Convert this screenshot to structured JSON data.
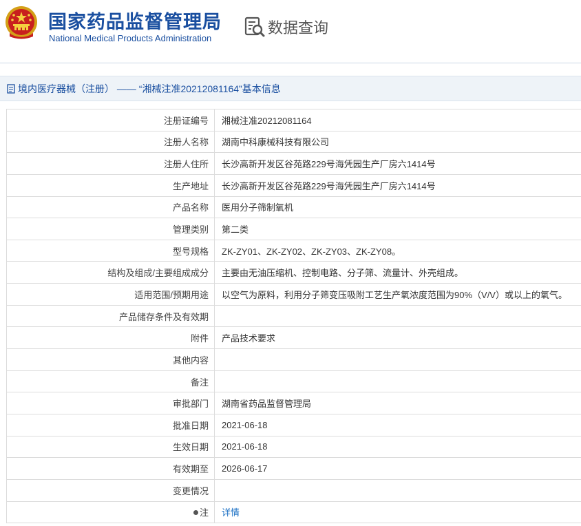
{
  "header": {
    "title_cn": "国家药品监督管理局",
    "title_en": "National Medical Products Administration",
    "query_label": "数据查询",
    "emblem_icon": "national-emblem-icon",
    "query_icon": "document-search-icon"
  },
  "breadcrumb": {
    "text": "境内医疗器械（注册） —— “湘械注准20212081164”基本信息",
    "icon": "document-icon"
  },
  "colors": {
    "brand": "#1a4fa0",
    "link": "#1a6fc4",
    "breadcrumb_bg": "#eef3f8",
    "border": "#dcdcdc"
  },
  "rows": [
    {
      "label": "注册证编号",
      "value": "湘械注准20212081164"
    },
    {
      "label": "注册人名称",
      "value": "湖南中科康械科技有限公司"
    },
    {
      "label": "注册人住所",
      "value": "长沙高新开发区谷苑路229号海凭园生产厂房六1414号"
    },
    {
      "label": "生产地址",
      "value": "长沙高新开发区谷苑路229号海凭园生产厂房六1414号"
    },
    {
      "label": "产品名称",
      "value": "医用分子筛制氧机"
    },
    {
      "label": "管理类别",
      "value": "第二类"
    },
    {
      "label": "型号规格",
      "value": "ZK-ZY01、ZK-ZY02、ZK-ZY03、ZK-ZY08。"
    },
    {
      "label": "结构及组成/主要组成成分",
      "value": "主要由无油压缩机、控制电路、分子筛、流量计、外壳组成。"
    },
    {
      "label": "适用范围/预期用途",
      "value": "以空气为原料，利用分子筛变压吸附工艺生产氧浓度范围为90%（V/V）或以上的氧气。"
    },
    {
      "label": "产品储存条件及有效期",
      "value": ""
    },
    {
      "label": "附件",
      "value": "产品技术要求"
    },
    {
      "label": "其他内容",
      "value": ""
    },
    {
      "label": "备注",
      "value": ""
    },
    {
      "label": "审批部门",
      "value": "湖南省药品监督管理局"
    },
    {
      "label": "批准日期",
      "value": "2021-06-18"
    },
    {
      "label": "生效日期",
      "value": "2021-06-18"
    },
    {
      "label": "有效期至",
      "value": "2026-06-17"
    },
    {
      "label": "变更情况",
      "value": ""
    }
  ],
  "note_row": {
    "label": "注",
    "link_text": "详情",
    "icon": "note-icon"
  }
}
